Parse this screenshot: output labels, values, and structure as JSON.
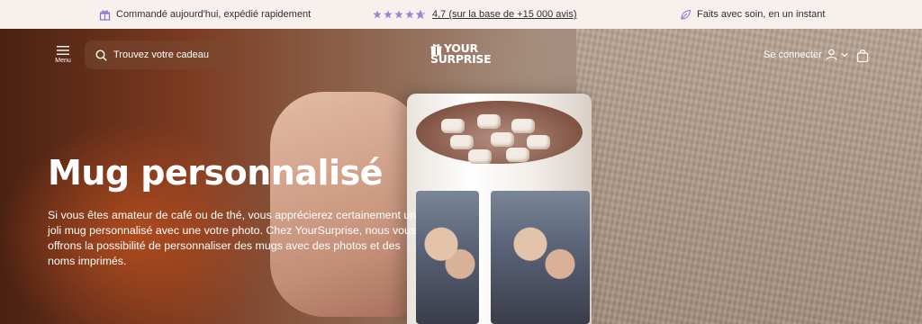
{
  "topbar": {
    "left_text": "Commandé aujourd'hui, expédié rapidement",
    "rating_stars": 4.7,
    "rating_text": "4,7 (sur la base de +15 000 avis)",
    "right_text": "Faits avec soin, en un instant",
    "icons": [
      "gift-box-icon",
      "star-icon",
      "leaf-icon"
    ]
  },
  "header": {
    "menu_label": "Menu",
    "search_placeholder": "Trouvez votre cadeau",
    "logo_line1": "YOUR",
    "logo_line2": "SURPRISE",
    "signin_label": "Se connecter",
    "icons": [
      "hamburger-icon",
      "search-icon",
      "gift-logo-icon",
      "user-icon",
      "chevron-down-icon",
      "shopping-bag-icon"
    ]
  },
  "hero": {
    "title": "Mug personnalisé",
    "description": "Si vous êtes amateur de café ou de thé, vous apprécierez certainement un joli mug personnalisé avec une votre photo. Chez YourSurprise, nous vous offrons la possibilité de personnaliser des mugs avec des photos et des noms imprimés."
  },
  "colors": {
    "topbar_bg": "#f7f0ec",
    "star_color": "#9b86d6",
    "text_dark": "#3b2a33"
  }
}
